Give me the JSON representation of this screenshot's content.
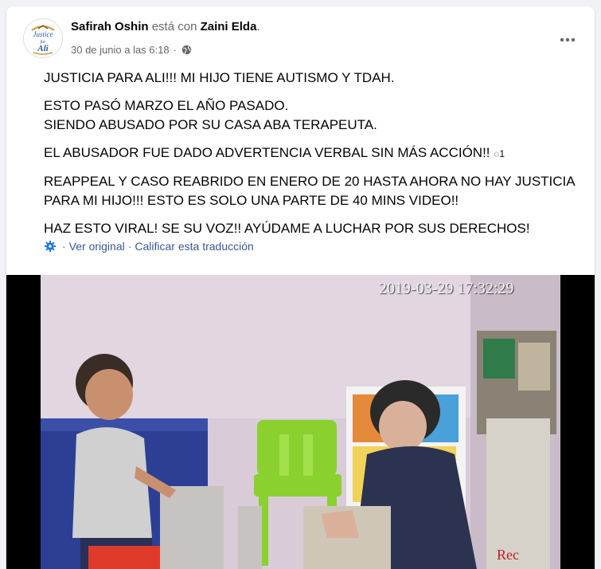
{
  "post": {
    "author": "Safirah Oshin",
    "with_text": "está con",
    "tagged": "Zaini Elda",
    "period": ".",
    "date": "30 de junio a las 6:18",
    "dot": "·",
    "audience_icon": "globe-icon",
    "more_icon": "more-options-icon",
    "avatar_text_top": "Justice",
    "avatar_text_mid": "for",
    "avatar_text_bottom": "Ali",
    "paragraphs": {
      "p1": "JUSTICIA PARA ALI!!! MI HIJO TIENE AUTISMO Y TDAH.",
      "p2a": "ESTO PASÓ MARZO EL AÑO PASADO.",
      "p2b": "SIENDO ABUSADO POR SU CASA ABA TERAPEUTA.",
      "p3": "EL ABUSADOR FUE DADO ADVERTENCIA VERBAL SIN MÁS ACCIÓN!!",
      "p3_glyph": "◌1",
      "p4": "REAPPEAL Y CASO REABRIDO EN ENERO DE 20 HASTA AHORA NO HAY JUSTICIA PARA MI HIJO!!! ESTO ES SOLO UNA PARTE DE 40 MINS VIDEO!!",
      "p5": "HAZ ESTO VIRAL! SE SU VOZ!! AYÚDAME A LUCHAR POR SUS DERECHOS!"
    },
    "translation": {
      "icon": "gear-icon",
      "sep": "·",
      "see_original": "Ver original",
      "rate": "Calificar esta traducción"
    }
  },
  "video": {
    "timestamp": "2019-03-29 17:32:29",
    "rec_label": "Rec"
  },
  "colors": {
    "text_primary": "#050505",
    "text_secondary": "#65676b",
    "link": "#385898",
    "background": "#f0f2f5"
  }
}
